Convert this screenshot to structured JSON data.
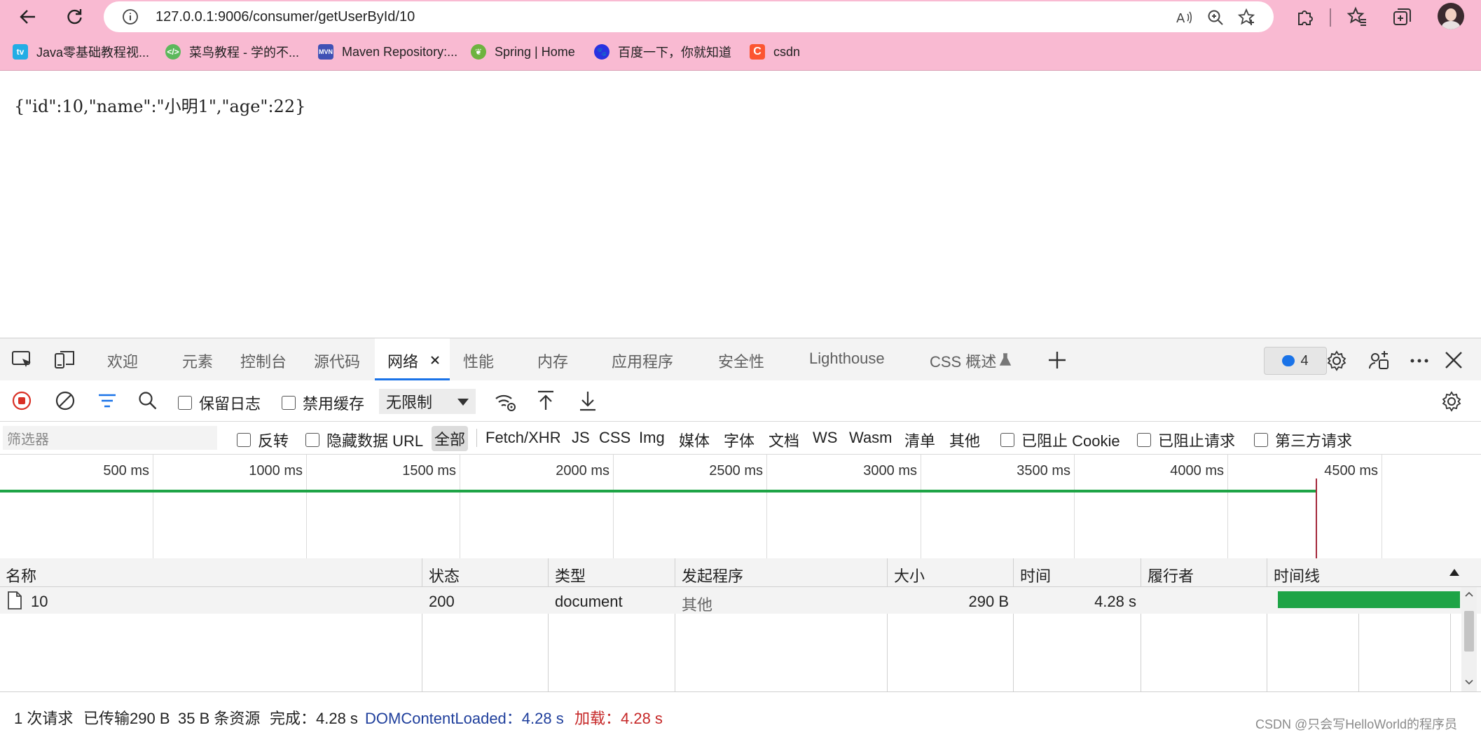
{
  "browser": {
    "url": "127.0.0.1:9006/consumer/getUserById/10",
    "bookmarks": [
      {
        "label": "Java零基础教程视...",
        "icon": "bilibili-icon",
        "color": "#23ade5"
      },
      {
        "label": "菜鸟教程 - 学的不...",
        "icon": "runoob-icon",
        "color": "#5cb85c"
      },
      {
        "label": "Maven Repository:...",
        "icon": "mvn-icon",
        "color": "#3f51b5"
      },
      {
        "label": "Spring | Home",
        "icon": "spring-icon",
        "color": "#6db33f"
      },
      {
        "label": "百度一下，你就知道",
        "icon": "baidu-icon",
        "color": "#2932e1"
      },
      {
        "label": "csdn",
        "icon": "csdn-icon",
        "color": "#fc5531"
      }
    ]
  },
  "page": {
    "json_text": "{\"id\":10,\"name\":\"小明1\",\"age\":22}"
  },
  "devtools": {
    "tabs": [
      "欢迎",
      "元素",
      "控制台",
      "源代码",
      "网络",
      "性能",
      "内存",
      "应用程序",
      "安全性",
      "Lighthouse",
      "CSS 概述"
    ],
    "active_tab": "网络",
    "issues_count": "4",
    "toolbar": {
      "preserve_log": "保留日志",
      "disable_cache": "禁用缓存",
      "throttle": "无限制"
    },
    "filter": {
      "placeholder": "筛选器",
      "invert": "反转",
      "hide_data_url": "隐藏数据 URL",
      "types": [
        "全部",
        "Fetch/XHR",
        "JS",
        "CSS",
        "Img",
        "媒体",
        "字体",
        "文档",
        "WS",
        "Wasm",
        "清单",
        "其他"
      ],
      "selected_type": "全部",
      "blocked_cookies": "已阻止 Cookie",
      "blocked_requests": "已阻止请求",
      "third_party": "第三方请求"
    },
    "overview": {
      "ticks": [
        "500 ms",
        "1000 ms",
        "1500 ms",
        "2000 ms",
        "2500 ms",
        "3000 ms",
        "3500 ms",
        "4000 ms",
        "4500 ms"
      ]
    },
    "grid": {
      "headers": [
        "名称",
        "状态",
        "类型",
        "发起程序",
        "大小",
        "时间",
        "履行者",
        "时间线"
      ],
      "rows": [
        {
          "name": "10",
          "status": "200",
          "type": "document",
          "initiator": "其他",
          "size": "290 B",
          "time": "4.28 s",
          "fulfilled": ""
        }
      ]
    },
    "summary": {
      "requests": "1 次请求",
      "transferred": "已传输290 B",
      "resources": "35 B 条资源",
      "finish": "完成：4.28 s",
      "dcl": "DOMContentLoaded：4.28 s",
      "load": "加载：4.28 s"
    }
  },
  "watermark": "CSDN @只会写HelloWorld的程序员",
  "colors": {
    "chrome_bg": "#f9bad2",
    "accent": "#1a73e8",
    "timeline_green": "#1ea446",
    "load_red": "#c62828",
    "dcl_blue": "#1f3f9c"
  }
}
